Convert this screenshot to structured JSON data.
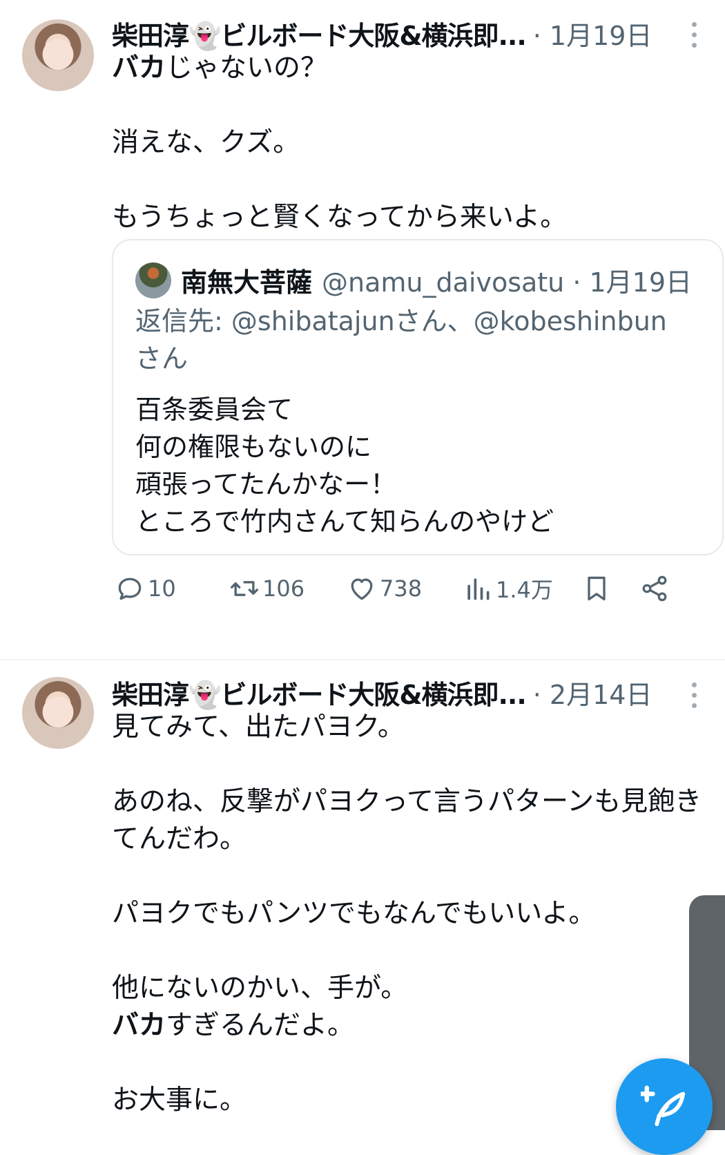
{
  "tweets": [
    {
      "author": "柴田淳👻ビルボード大阪&横浜即...",
      "date": "· 1月19日",
      "body_bold": "バカ",
      "body_rest": "じゃないの？\n\n消えな、クズ。\n\nもうちょっと賢くなってから来いよ。",
      "quote": {
        "name": "南無大菩薩",
        "handle": "@namu_daivosatu · 1月19日",
        "reply_prefix": "返信先: ",
        "reply_text": "@shibatajunさん、@kobeshinbun さん",
        "text": "百条委員会て\n何の権限もないのに\n頑張ってたんかなー！\nところで竹内さんて知らんのやけど"
      },
      "actions": {
        "replies": "10",
        "retweets": "106",
        "likes": "738",
        "views": "1.4万"
      }
    },
    {
      "author": "柴田淳👻ビルボード大阪&横浜即...",
      "date": "· 2月14日",
      "body_pre": "見てみて、出たパヨク。\n\nあのね、反撃がパヨクって言うパターンも見飽き\nてんだわ。\n\nパヨクでもパンツでもなんでもいいよ。\n\n他にないのかい、手が。\n",
      "body_bold": "バカ",
      "body_post": "すぎるんだよ。\n\nお大事に。"
    }
  ],
  "icons": {
    "reply": "reply-icon",
    "retweet": "retweet-icon",
    "like": "heart-icon",
    "views": "views-icon",
    "bookmark": "bookmark-icon",
    "share": "share-icon",
    "compose": "compose-icon"
  },
  "colors": {
    "accent": "#1d9bf0",
    "secondary_text": "#536471"
  }
}
